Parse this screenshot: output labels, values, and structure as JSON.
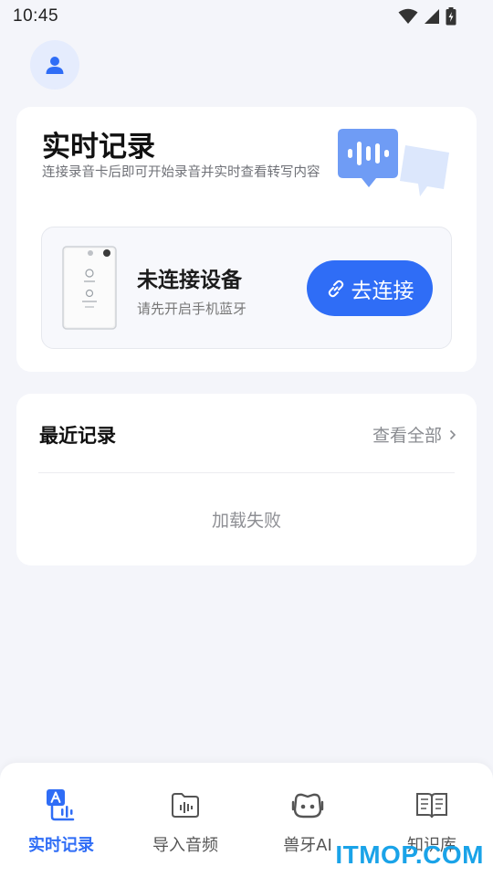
{
  "status_bar": {
    "time": "10:45"
  },
  "live_card": {
    "title": "实时记录",
    "subtitle": "连接录音卡后即可开始录音并实时查看转写内容",
    "device": {
      "status": "未连接设备",
      "hint": "请先开启手机蓝牙",
      "connect_label": "去连接"
    }
  },
  "recent_card": {
    "title": "最近记录",
    "view_all_label": "查看全部",
    "empty_message": "加载失败"
  },
  "bottom_nav": {
    "items": [
      {
        "label": "实时记录",
        "icon": "live-record-icon",
        "active": true
      },
      {
        "label": "导入音频",
        "icon": "import-audio-icon",
        "active": false
      },
      {
        "label": "兽牙AI",
        "icon": "ai-bot-icon",
        "active": false
      },
      {
        "label": "知识库",
        "icon": "knowledge-book-icon",
        "active": false
      }
    ]
  },
  "watermark": "ITMOP.COM",
  "colors": {
    "accent": "#2f6df6",
    "background": "#f4f5fa",
    "card": "#ffffff",
    "watermark": "#1aa3e8"
  }
}
